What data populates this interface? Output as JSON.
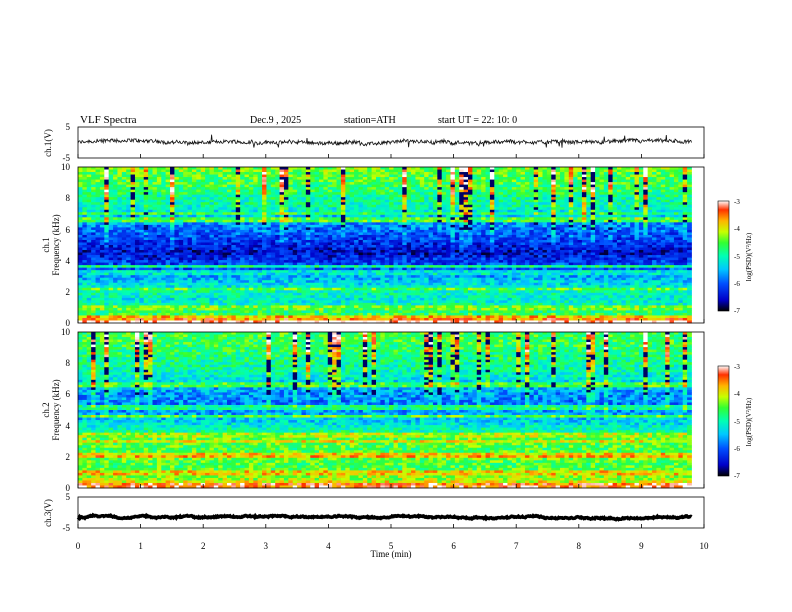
{
  "header": {
    "title": "VLF  Spectra",
    "date": "Dec.9  , 2025",
    "station": "station=ATH",
    "start": "start  UT  =    22: 10: 0"
  },
  "colors": {
    "background": "#ffffff",
    "axis": "#000000",
    "waveform": "#111111",
    "colormap": [
      "#000000",
      "#0000c8",
      "#0050ff",
      "#00c8ff",
      "#00ffb4",
      "#32ff32",
      "#c8ff00",
      "#ffb400",
      "#ff3200",
      "#ffffff"
    ]
  },
  "chart_data": [
    {
      "type": "line",
      "id": "ch1-waveform",
      "ylabel": "ch.1(V)",
      "yticks": [
        "5",
        "-5"
      ],
      "ylim": [
        -5,
        5
      ],
      "xlim": [
        0,
        10
      ],
      "series": [
        {
          "values_approx_mean": 0,
          "noise_amplitude": 1.2,
          "x_end": 9.8
        }
      ]
    },
    {
      "type": "heatmap",
      "id": "ch1-spectrogram",
      "ylabel": "ch.1\nFrequency  (kHz)",
      "ylabel_lines": [
        "ch.1",
        "Frequency  (kHz)"
      ],
      "yticks": [
        "0",
        "2",
        "4",
        "6",
        "8",
        "10"
      ],
      "ylim": [
        0,
        10
      ],
      "xlim": [
        0,
        10
      ],
      "x_end": 9.8,
      "colorbar": {
        "label": "log(PSD)(V²/Hz)",
        "ticks": [
          "-3",
          "-4",
          "-5",
          "-6",
          "-7"
        ],
        "range": [
          -7,
          -3
        ]
      },
      "profile": [
        {
          "f": 0.2,
          "level": -3.4
        },
        {
          "f": 0.5,
          "level": -4.6
        },
        {
          "f": 1.0,
          "level": -4.9
        },
        {
          "f": 1.5,
          "level": -5.2
        },
        {
          "f": 2.0,
          "level": -5.0
        },
        {
          "f": 2.5,
          "level": -5.3
        },
        {
          "f": 3.0,
          "level": -5.6
        },
        {
          "f": 3.5,
          "level": -6.0
        },
        {
          "f": 4.0,
          "level": -6.2
        },
        {
          "f": 4.5,
          "level": -6.5
        },
        {
          "f": 5.0,
          "level": -6.3
        },
        {
          "f": 5.5,
          "level": -6.1
        },
        {
          "f": 6.0,
          "level": -5.9
        },
        {
          "f": 6.5,
          "level": -5.6
        },
        {
          "f": 7.0,
          "level": -5.3
        },
        {
          "f": 7.5,
          "level": -5.0
        },
        {
          "f": 8.0,
          "level": -4.9
        },
        {
          "f": 8.5,
          "level": -4.7
        },
        {
          "f": 9.0,
          "level": -4.6
        },
        {
          "f": 9.5,
          "level": -4.5
        },
        {
          "f": 10.0,
          "level": -4.5
        }
      ],
      "lines": [
        {
          "f": 0.1,
          "level": -3.3
        },
        {
          "f": 0.3,
          "level": -3.8
        },
        {
          "f": 1.0,
          "level": -4.4
        },
        {
          "f": 2.2,
          "level": -4.5
        },
        {
          "f": 3.2,
          "level": -5.2
        },
        {
          "f": 3.6,
          "level": -4.9
        },
        {
          "f": 6.6,
          "level": -4.6
        },
        {
          "f": 7.0,
          "level": -4.7
        },
        {
          "f": 9.8,
          "level": -4.4
        }
      ]
    },
    {
      "type": "heatmap",
      "id": "ch2-spectrogram",
      "ylabel": "ch.2\nFrequency  (kHz)",
      "ylabel_lines": [
        "ch.2",
        "Frequency  (kHz)"
      ],
      "yticks": [
        "0",
        "2",
        "4",
        "6",
        "8",
        "10"
      ],
      "ylim": [
        0,
        10
      ],
      "xlim": [
        0,
        10
      ],
      "x_end": 9.8,
      "colorbar": {
        "label": "log(PSD)(V²/Hz)",
        "ticks": [
          "-3",
          "-4",
          "-5",
          "-6",
          "-7"
        ],
        "range": [
          -7,
          -3
        ]
      },
      "profile": [
        {
          "f": 0.2,
          "level": -3.6
        },
        {
          "f": 0.5,
          "level": -4.2
        },
        {
          "f": 1.0,
          "level": -4.4
        },
        {
          "f": 1.5,
          "level": -4.6
        },
        {
          "f": 2.0,
          "level": -4.3
        },
        {
          "f": 2.5,
          "level": -4.6
        },
        {
          "f": 3.0,
          "level": -4.4
        },
        {
          "f": 3.5,
          "level": -4.8
        },
        {
          "f": 4.0,
          "level": -5.2
        },
        {
          "f": 4.5,
          "level": -5.5
        },
        {
          "f": 5.0,
          "level": -5.7
        },
        {
          "f": 5.5,
          "level": -5.8
        },
        {
          "f": 6.0,
          "level": -5.7
        },
        {
          "f": 6.5,
          "level": -5.5
        },
        {
          "f": 7.0,
          "level": -5.2
        },
        {
          "f": 7.5,
          "level": -5.0
        },
        {
          "f": 8.0,
          "level": -4.9
        },
        {
          "f": 8.5,
          "level": -4.8
        },
        {
          "f": 9.0,
          "level": -4.7
        },
        {
          "f": 9.5,
          "level": -4.6
        },
        {
          "f": 10.0,
          "level": -4.6
        }
      ],
      "lines": [
        {
          "f": 0.2,
          "level": -3.4
        },
        {
          "f": 1.0,
          "level": -3.9
        },
        {
          "f": 2.0,
          "level": -3.7
        },
        {
          "f": 2.2,
          "level": -3.9
        },
        {
          "f": 3.0,
          "level": -4.0
        },
        {
          "f": 3.4,
          "level": -4.2
        },
        {
          "f": 4.6,
          "level": -4.5
        },
        {
          "f": 5.2,
          "level": -4.9
        },
        {
          "f": 6.6,
          "level": -4.6
        }
      ]
    },
    {
      "type": "line",
      "id": "ch3-waveform",
      "ylabel": "ch.3(V)",
      "yticks": [
        "5",
        "-5"
      ],
      "ylim": [
        -5,
        5
      ],
      "xlim": [
        0,
        10
      ],
      "xlabel": "Time  (min)",
      "xticks": [
        "0",
        "1",
        "2",
        "3",
        "4",
        "5",
        "6",
        "7",
        "8",
        "9",
        "10"
      ],
      "series": [
        {
          "values_approx_mean": -1.5,
          "noise_amplitude": 0.3,
          "x_end": 9.8
        }
      ]
    }
  ]
}
